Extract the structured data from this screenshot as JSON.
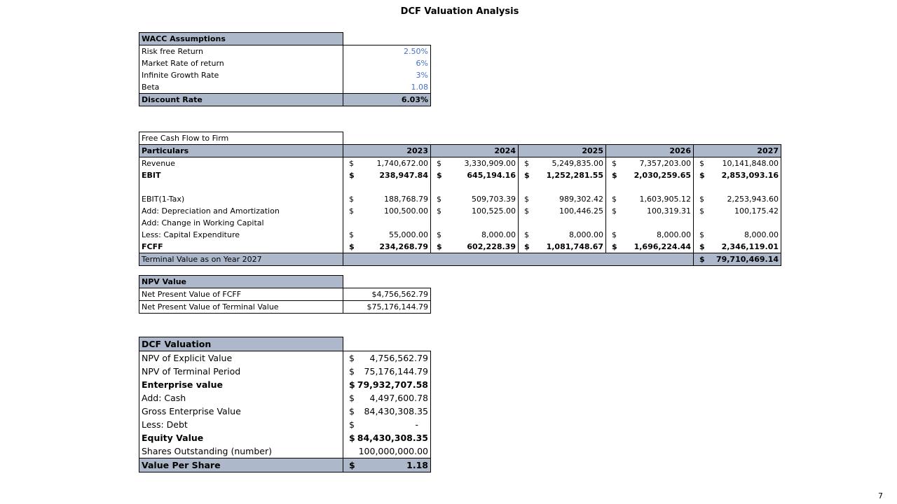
{
  "page": {
    "title": "DCF Valuation Analysis",
    "number": "7"
  },
  "wacc": {
    "header": "WACC Assumptions",
    "rows": [
      {
        "label": "Risk free Return",
        "value": "2.50%"
      },
      {
        "label": "Market Rate of return",
        "value": "6%"
      },
      {
        "label": "Infinite Growth Rate",
        "value": "3%"
      },
      {
        "label": "Beta",
        "value": "1.08"
      }
    ],
    "total": {
      "label": "Discount Rate",
      "value": "6.03%"
    }
  },
  "fcf": {
    "title": "Free Cash Flow to Firm",
    "header_label": "Particulars",
    "years": [
      "2023",
      "2024",
      "2025",
      "2026",
      "2027"
    ],
    "currency": "$",
    "rows": [
      {
        "label": "Revenue",
        "values": [
          "1,740,672.00",
          "3,330,909.00",
          "5,249,835.00",
          "7,357,203.00",
          "10,141,848.00"
        ]
      },
      {
        "label": "EBIT",
        "values": [
          "238,947.84",
          "645,194.16",
          "1,252,281.55",
          "2,030,259.65",
          "2,853,093.16"
        ]
      },
      {
        "label": "EBIT(1-Tax)",
        "values": [
          "188,768.79",
          "509,703.39",
          "989,302.42",
          "1,603,905.12",
          "2,253,943.60"
        ]
      },
      {
        "label": "Add: Depreciation and Amortization",
        "values": [
          "100,500.00",
          "100,525.00",
          "100,446.25",
          "100,319.31",
          "100,175.42"
        ]
      },
      {
        "label": "Add: Change in Working Capital"
      },
      {
        "label": "Less: Capital Expenditure",
        "values": [
          "55,000.00",
          "8,000.00",
          "8,000.00",
          "8,000.00",
          "8,000.00"
        ]
      },
      {
        "label": "FCFF",
        "values": [
          "234,268.79",
          "602,228.39",
          "1,081,748.67",
          "1,696,224.44",
          "2,346,119.01"
        ]
      }
    ],
    "terminal": {
      "label": "Terminal Value as on Year 2027",
      "value": "79,710,469.14"
    }
  },
  "npv": {
    "header": "NPV Value",
    "rows": [
      {
        "label": "Net Present Value of FCFF",
        "value": "$4,756,562.79"
      },
      {
        "label": "Net Present Value of Terminal Value",
        "value": "$75,176,144.79"
      }
    ]
  },
  "dcf": {
    "header": "DCF Valuation",
    "currency": "$",
    "rows": [
      {
        "label": "NPV of Explicit Value",
        "value": "4,756,562.79"
      },
      {
        "label": "NPV of Terminal Period",
        "value": "75,176,144.79"
      },
      {
        "label": "Enterprise value",
        "value": "79,932,707.58"
      },
      {
        "label": "Add: Cash",
        "value": "4,497,600.78"
      },
      {
        "label": "Gross Enterprise Value",
        "value": "84,430,308.35"
      },
      {
        "label": "Less: Debt",
        "value": "-"
      },
      {
        "label": "Equity Value",
        "value": "84,430,308.35"
      },
      {
        "label": "Shares Outstanding (number)",
        "value": "100,000,000.00"
      }
    ],
    "total": {
      "label": "Value Per Share",
      "value": "1.18"
    }
  }
}
